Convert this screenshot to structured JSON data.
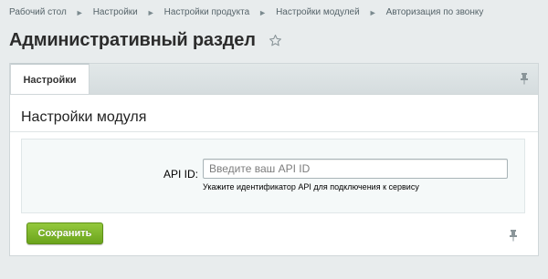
{
  "breadcrumb": {
    "items": [
      {
        "label": "Рабочий стол"
      },
      {
        "label": "Настройки"
      },
      {
        "label": "Настройки продукта"
      },
      {
        "label": "Настройки модулей"
      },
      {
        "label": "Авторизация по звонку"
      }
    ],
    "separator": "►"
  },
  "header": {
    "title": "Административный раздел",
    "favorite_icon": "star-icon"
  },
  "tabs": {
    "items": [
      {
        "label": "Настройки",
        "active": true
      }
    ],
    "pin_icon": "pin-icon"
  },
  "panel": {
    "section_title": "Настройки модуля",
    "form": {
      "api_id": {
        "label": "API ID:",
        "value": "",
        "placeholder": "Введите ваш API ID",
        "hint": "Укажите идентификатор API для подключения к сервису"
      }
    },
    "save_label": "Сохранить",
    "pin_icon": "pin-icon"
  },
  "colors": {
    "background": "#e8eced",
    "save_button": "#7ab12a",
    "panel": "#ffffff"
  }
}
